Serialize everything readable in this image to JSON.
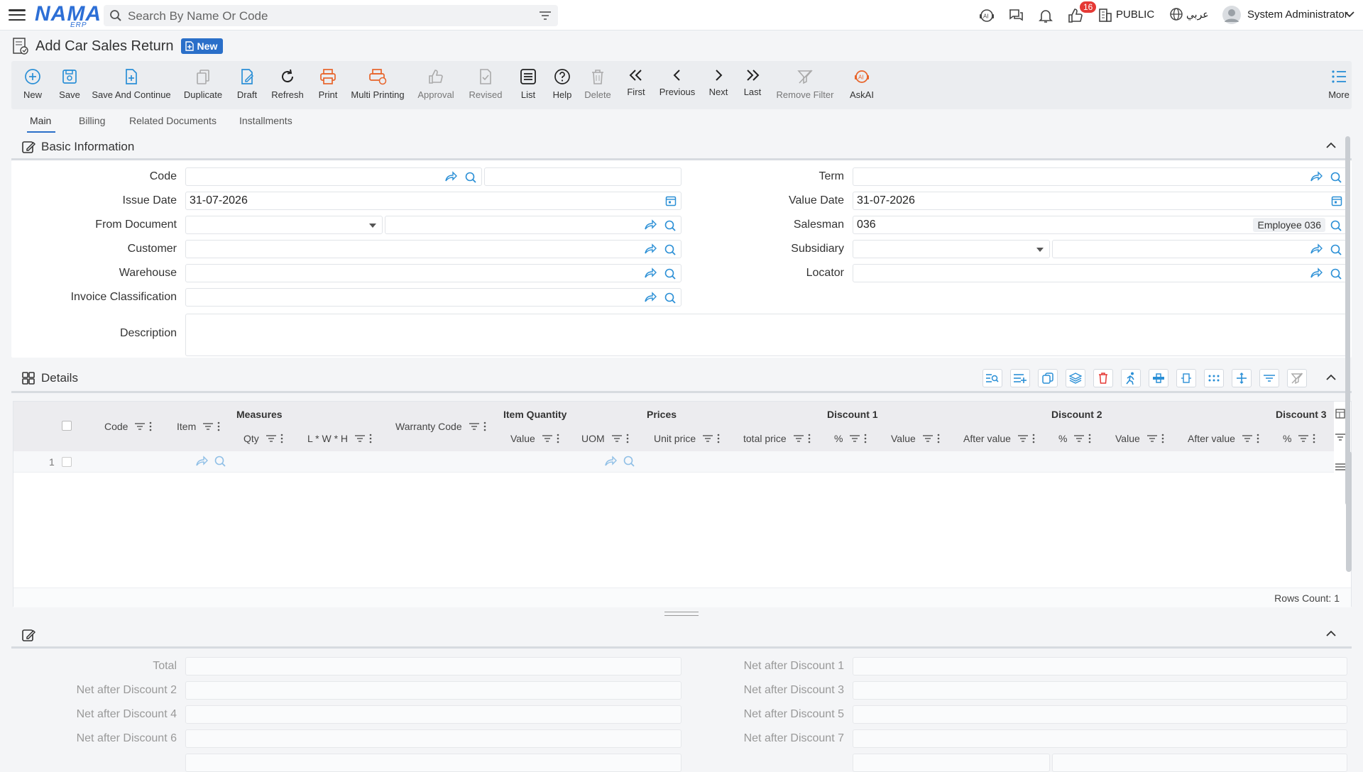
{
  "app": {
    "logo_text": "NAMA",
    "logo_sub": "ERP",
    "search_placeholder": "Search By Name Or Code",
    "notification_count": "16",
    "public_label": "PUBLIC",
    "language_label": "عربي",
    "user_name": "System Administrator"
  },
  "page": {
    "title": "Add Car Sales Return",
    "status_badge": "New"
  },
  "toolbar": {
    "new": "New",
    "save": "Save",
    "save_continue": "Save And Continue",
    "duplicate": "Duplicate",
    "draft": "Draft",
    "refresh": "Refresh",
    "print": "Print",
    "multi_printing": "Multi Printing",
    "approval": "Approval",
    "revised": "Revised",
    "list": "List",
    "help": "Help",
    "delete": "Delete",
    "first": "First",
    "previous": "Previous",
    "next": "Next",
    "last": "Last",
    "remove_filter": "Remove Filter",
    "askai": "AskAI",
    "more": "More"
  },
  "tabs": {
    "main": "Main",
    "billing": "Billing",
    "related": "Related Documents",
    "installments": "Installments"
  },
  "basic": {
    "title": "Basic Information",
    "code_label": "Code",
    "issue_date_label": "Issue Date",
    "issue_date_value": "31-07-2026",
    "from_document_label": "From Document",
    "customer_label": "Customer",
    "warehouse_label": "Warehouse",
    "invoice_class_label": "Invoice Classification",
    "description_label": "Description",
    "term_label": "Term",
    "value_date_label": "Value Date",
    "value_date_value": "31-07-2026",
    "salesman_label": "Salesman",
    "salesman_code": "036",
    "salesman_name": "Employee 036",
    "subsidiary_label": "Subsidiary",
    "locator_label": "Locator"
  },
  "details": {
    "title": "Details",
    "groups": {
      "measures": "Measures",
      "item_quantity": "Item Quantity",
      "prices": "Prices",
      "discount1": "Discount 1",
      "discount2": "Discount 2",
      "discount3": "Discount 3"
    },
    "columns": {
      "code": "Code",
      "item": "Item",
      "qty": "Qty",
      "lwh": "L * W * H",
      "warranty_code": "Warranty Code",
      "value": "Value",
      "uom": "UOM",
      "unit_price": "Unit price",
      "total_price": "total price",
      "d1_pct": "%",
      "d1_value": "Value",
      "d1_after": "After value",
      "d2_pct": "%",
      "d2_value": "Value",
      "d2_after": "After value",
      "d3_pct": "%"
    },
    "row_number": "1",
    "rows_count": "Rows Count: 1"
  },
  "totals": {
    "total": "Total",
    "net_after_discount_1": "Net after Discount 1",
    "net_after_discount_2": "Net after Discount 2",
    "net_after_discount_3": "Net after Discount 3",
    "net_after_discount_4": "Net after Discount 4",
    "net_after_discount_5": "Net after Discount 5",
    "net_after_discount_6": "Net after Discount 6",
    "net_after_discount_7": "Net after Discount 7"
  },
  "colors": {
    "accent": "#2a6fc9",
    "link_icon": "#2a8fd6",
    "print_orange": "#e8642a",
    "danger": "#e53935"
  }
}
